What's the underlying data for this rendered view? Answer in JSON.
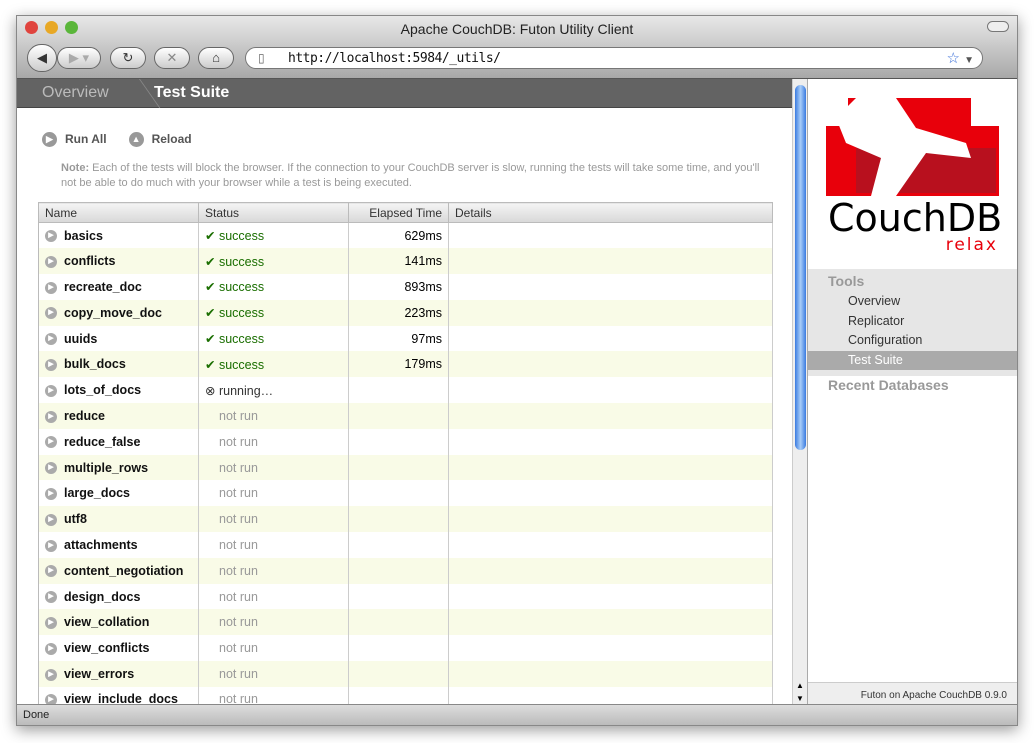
{
  "window": {
    "title": "Apache CouchDB: Futon Utility Client",
    "url": "http://localhost:5984/_utils/",
    "status": "Done"
  },
  "breadcrumb": {
    "parent": "Overview",
    "current": "Test Suite"
  },
  "actions": {
    "run_all": "Run All",
    "reload": "Reload"
  },
  "note": {
    "label": "Note:",
    "text": " Each of the tests will block the browser. If the connection to your CouchDB server is slow, running the tests will take some time, and you'll not be able to do much with your browser while a test is being executed."
  },
  "table": {
    "headers": [
      "Name",
      "Status",
      "Elapsed Time",
      "Details"
    ],
    "rows": [
      {
        "name": "basics",
        "status": "success",
        "elapsed": "629ms"
      },
      {
        "name": "conflicts",
        "status": "success",
        "elapsed": "141ms"
      },
      {
        "name": "recreate_doc",
        "status": "success",
        "elapsed": "893ms"
      },
      {
        "name": "copy_move_doc",
        "status": "success",
        "elapsed": "223ms"
      },
      {
        "name": "uuids",
        "status": "success",
        "elapsed": "97ms"
      },
      {
        "name": "bulk_docs",
        "status": "success",
        "elapsed": "179ms"
      },
      {
        "name": "lots_of_docs",
        "status": "running…",
        "elapsed": ""
      },
      {
        "name": "reduce",
        "status": "not run",
        "elapsed": ""
      },
      {
        "name": "reduce_false",
        "status": "not run",
        "elapsed": ""
      },
      {
        "name": "multiple_rows",
        "status": "not run",
        "elapsed": ""
      },
      {
        "name": "large_docs",
        "status": "not run",
        "elapsed": ""
      },
      {
        "name": "utf8",
        "status": "not run",
        "elapsed": ""
      },
      {
        "name": "attachments",
        "status": "not run",
        "elapsed": ""
      },
      {
        "name": "content_negotiation",
        "status": "not run",
        "elapsed": ""
      },
      {
        "name": "design_docs",
        "status": "not run",
        "elapsed": ""
      },
      {
        "name": "view_collation",
        "status": "not run",
        "elapsed": ""
      },
      {
        "name": "view_conflicts",
        "status": "not run",
        "elapsed": ""
      },
      {
        "name": "view_errors",
        "status": "not run",
        "elapsed": ""
      },
      {
        "name": "view_include_docs",
        "status": "not run",
        "elapsed": ""
      }
    ]
  },
  "sidebar": {
    "logo_text": "CouchDB",
    "logo_tagline": "relax",
    "tools_heading": "Tools",
    "items": [
      "Overview",
      "Replicator",
      "Configuration",
      "Test Suite"
    ],
    "selected": "Test Suite",
    "recent_heading": "Recent Databases",
    "footer": "Futon on Apache CouchDB 0.9.0"
  },
  "colors": {
    "success": "#1a6e00",
    "logo_red": "#e8000b",
    "crumb_bg": "#636363"
  }
}
